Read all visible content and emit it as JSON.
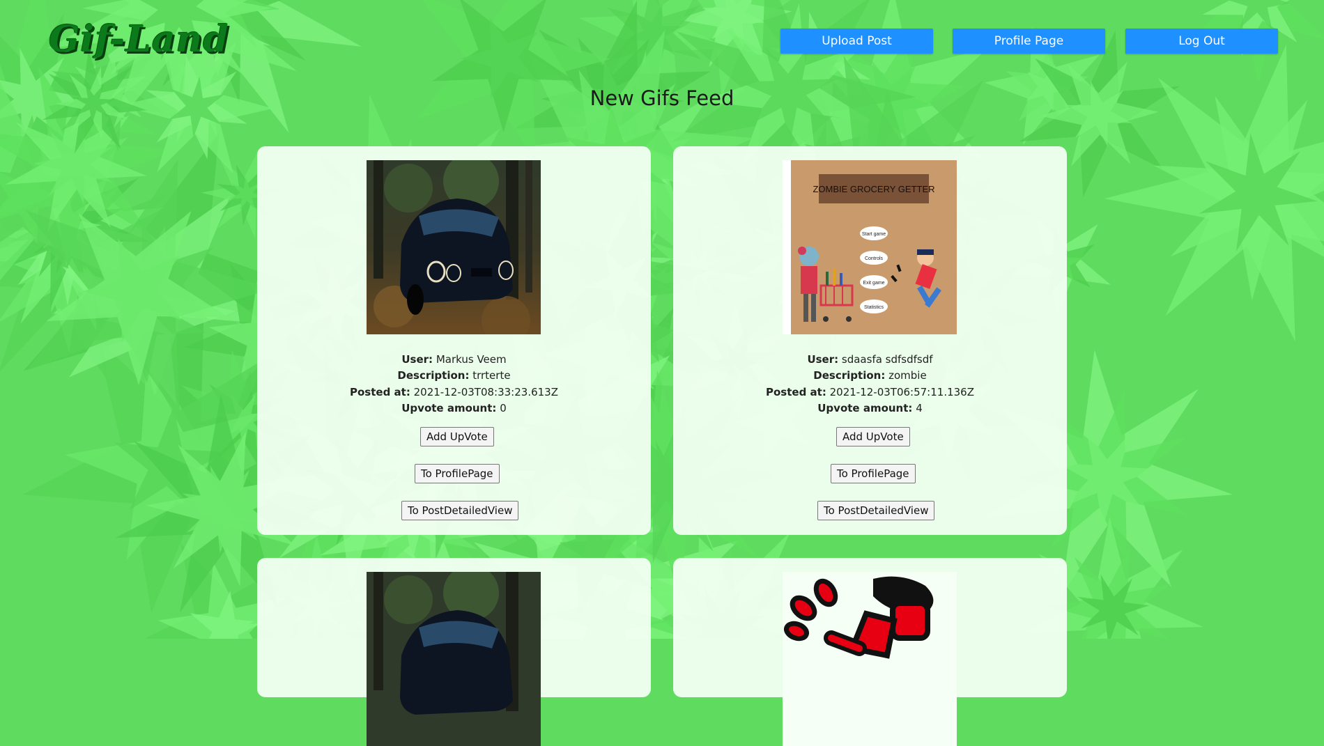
{
  "header": {
    "logo": "Gif-Land",
    "nav": {
      "upload": "Upload Post",
      "profile": "Profile Page",
      "logout": "Log Out"
    }
  },
  "feed": {
    "title": "New Gifs Feed",
    "labels": {
      "user": "User:",
      "description": "Description:",
      "posted_at": "Posted at:",
      "upvote_amount": "Upvote amount:"
    },
    "buttons": {
      "upvote": "Add UpVote",
      "profile": "To ProfilePage",
      "detail": "To PostDetailedView"
    },
    "posts": [
      {
        "user": "Markus Veem",
        "description": "trrterte",
        "posted_at": "2021-12-03T08:33:23.613Z",
        "upvotes": "0",
        "image": "black-car-photo"
      },
      {
        "user": "sdaasfa sdfsdfsdf",
        "description": "zombie",
        "posted_at": "2021-12-03T06:57:11.136Z",
        "upvotes": "4",
        "image": "zombie-grocery-getter-game",
        "image_text": {
          "title": "ZOMBIE GROCERY GETTER",
          "menu": [
            "Start game",
            "Controls",
            "Exit game",
            "Statistics"
          ]
        }
      },
      {
        "image": "black-car-photo"
      },
      {
        "image": "running-man-icon"
      }
    ]
  },
  "colors": {
    "background": "#5fdc5f",
    "nav_button": "#1e90ff",
    "logo": "#0b7a1b",
    "card": "#f5fff5"
  }
}
